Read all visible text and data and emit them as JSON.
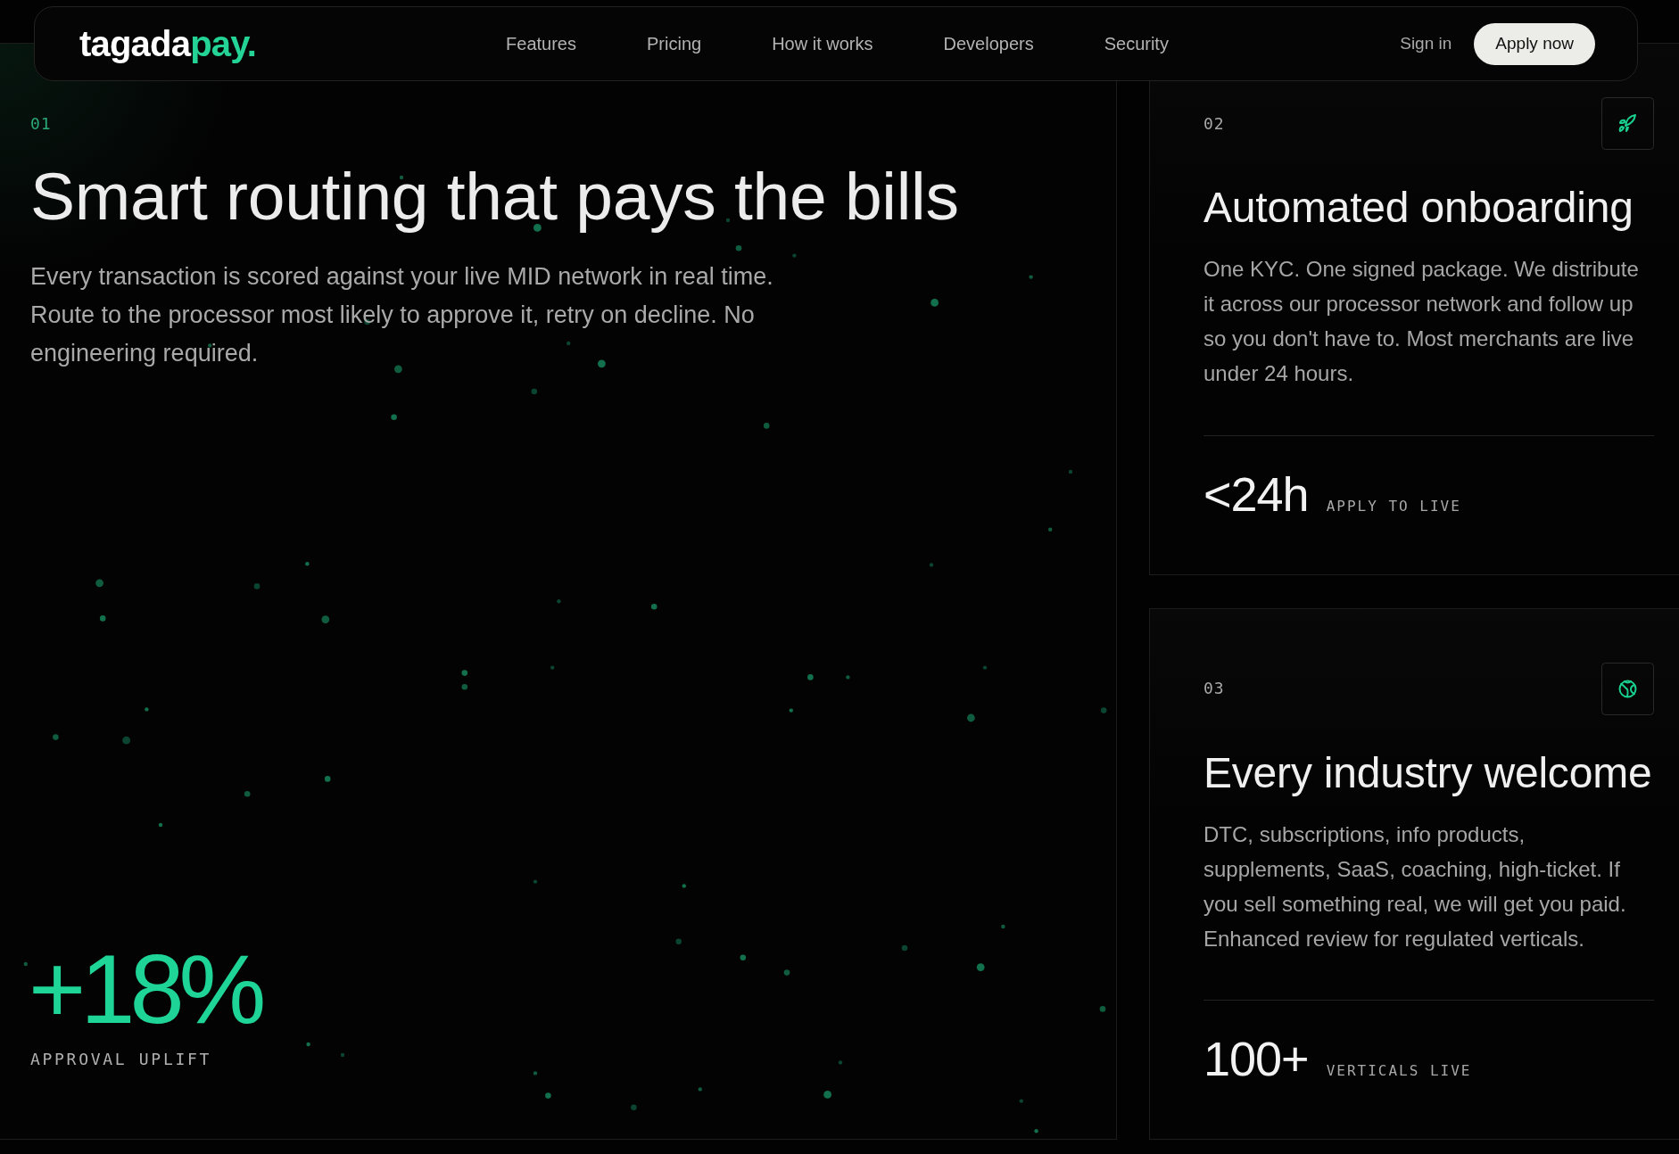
{
  "nav": {
    "logo": {
      "text": "tagada",
      "accent": "pay."
    },
    "links": [
      "Features",
      "Pricing",
      "How it works",
      "Developers",
      "Security"
    ],
    "sign_in": "Sign in",
    "cta": "Apply now"
  },
  "hero": {
    "number": "01",
    "title": "Smart routing that pays the bills",
    "body": "Every transaction is scored against your live MID network in real time. Route to the processor most likely to approve it, retry on decline. No engineering required.",
    "stat": {
      "value": "+18%",
      "label": "APPROVAL UPLIFT"
    }
  },
  "cards": [
    {
      "number": "02",
      "title": "Automated onboarding",
      "body": "One KYC. One signed package. We distribute it across our processor network and follow up so you don't have to. Most merchants are live under 24 hours.",
      "stat": {
        "value": "<24h",
        "label": "APPLY TO LIVE"
      }
    },
    {
      "number": "03",
      "title": "Every industry welcome",
      "body": "DTC, subscriptions, info products, supplements, SaaS, coaching, high-ticket. If you sell something real, we will get you paid. Enhanced review for regulated verticals.",
      "stat": {
        "value": "100+",
        "label": "VERTICALS LIVE"
      }
    }
  ]
}
